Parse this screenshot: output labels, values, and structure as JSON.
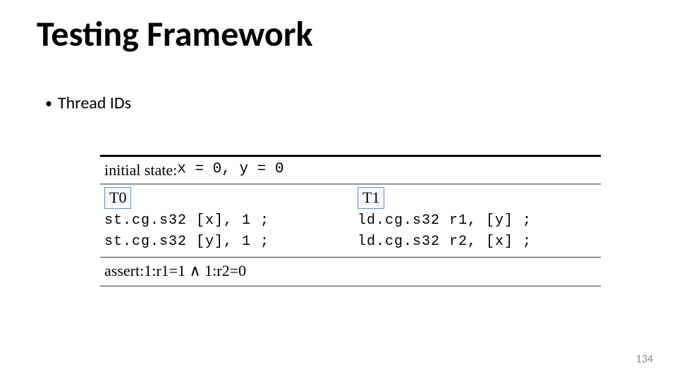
{
  "title": "Testing Framework",
  "bullet": "Thread IDs",
  "figure": {
    "initial_prefix": "initial state: ",
    "initial_vars": "x = 0, y = 0",
    "threads": {
      "t0": {
        "label": "T0",
        "lines": [
          "st.cg.s32 [x], 1 ;",
          "st.cg.s32 [y], 1 ;"
        ]
      },
      "t1": {
        "label": "T1",
        "lines": [
          "ld.cg.s32 r1, [y] ;",
          "ld.cg.s32 r2, [x] ;"
        ]
      }
    },
    "assert_prefix": "assert: ",
    "assert_expr": "1:r1=1 ∧ 1:r2=0"
  },
  "page_number": "134"
}
